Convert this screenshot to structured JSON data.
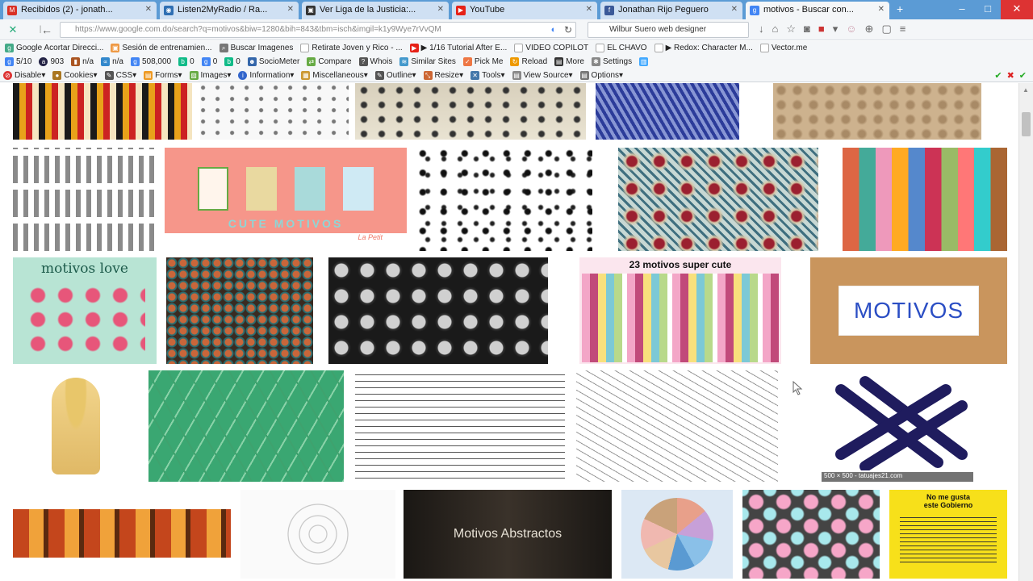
{
  "tabs": [
    {
      "label": "Recibidos (2) - jonath...",
      "color": "#d93025",
      "icon": "gmail-icon"
    },
    {
      "label": "Listen2MyRadio / Ra...",
      "color": "#2f6fb3",
      "icon": "radio-icon"
    },
    {
      "label": "Ver Liga de la Justicia:...",
      "color": "#333333",
      "icon": "tv-icon"
    },
    {
      "label": "YouTube",
      "color": "#e62117",
      "icon": "youtube-icon"
    },
    {
      "label": "Jonathan Rijo Peguero",
      "color": "#3b5998",
      "icon": "facebook-icon"
    },
    {
      "label": "motivos - Buscar con...",
      "color": "#4285f4",
      "icon": "google-icon"
    }
  ],
  "new_tab": "+",
  "url": "https://www.google.com.do/search?q=motivos&biw=1280&bih=843&tbm=isch&imgil=k1y9Wye7rVvQM",
  "search_value": "Wilbur Suero web designer",
  "bookmarks": [
    "Google Acortar Direcci...",
    "Sesión de entrenamien...",
    "Buscar Imagenes",
    "Retirate Joven y Rico - ...",
    "▶ 1/16 Tutorial After E...",
    "VIDEO COPILOT",
    "EL CHAVO",
    "▶ Redox: Character M...",
    "Vector.me"
  ],
  "seo": {
    "pr": "5/10",
    "alexa": "903",
    "idx": "n/a",
    "links": "n/a",
    "rank": "508,000",
    "b1": "0",
    "b2": "0",
    "b3": "0",
    "items": [
      "SocioMeter",
      "Compare",
      "Whois",
      "Similar Sites",
      "Pick Me",
      "Reload",
      "More",
      "Settings"
    ]
  },
  "dev": [
    "Disable",
    "Cookies",
    "CSS",
    "Forms",
    "Images",
    "Information",
    "Miscellaneous",
    "Outline",
    "Resize",
    "Tools",
    "View Source",
    "Options"
  ],
  "images": {
    "cute_text": "CUTE MOTIVOS",
    "cute_sign": "La Petit",
    "love_text": "motivos love",
    "super_text": "23 motivos super cute",
    "motivos_sign": "MOTIVOS",
    "dims_text": "500 × 500 - tatuajes21.com",
    "abstract_text": "Motivos Abstractos",
    "gobierno_text1": "No me gusta",
    "gobierno_text2": "este Gobierno"
  }
}
